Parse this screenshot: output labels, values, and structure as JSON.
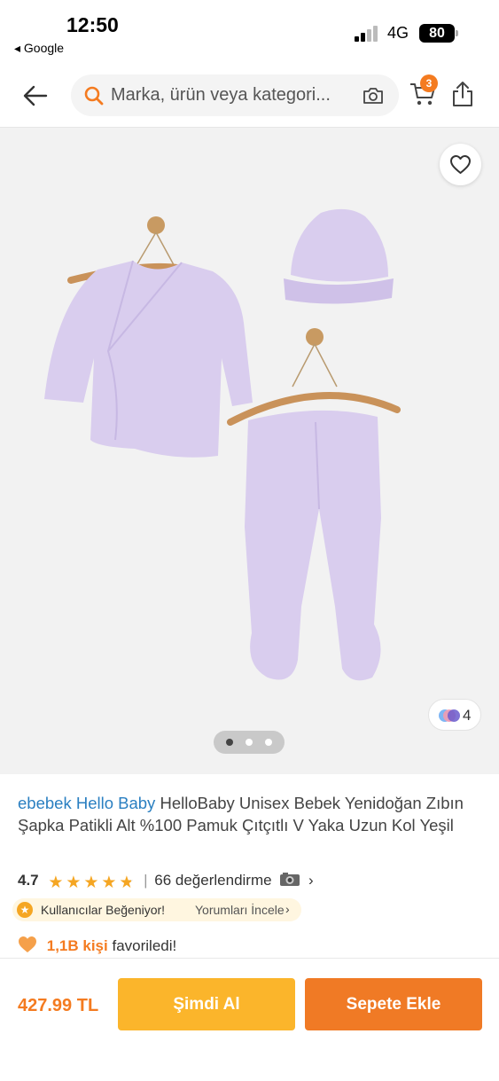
{
  "status_bar": {
    "time": "12:50",
    "back_app": "◂ Google",
    "network": "4G",
    "battery": "80"
  },
  "header": {
    "search_placeholder": "Marka, ürün veya kategori...",
    "cart_count": "3"
  },
  "gallery": {
    "color_variants_count": "4",
    "pager": {
      "total": 3,
      "active": 1
    }
  },
  "product": {
    "brand": "ebebek Hello Baby",
    "title": " HelloBaby Unisex Bebek Yenidoğan Zıbın Şapka Patikli Alt %100 Pamuk Çıtçıtlı V Yaka Uzun Kol Yeşil",
    "rating": "4.7",
    "rating_stars": 4.7,
    "reviews_separator": "|",
    "reviews": "66 değerlendirme",
    "liked_badge": "Kullanıcılar Beğeniyor!",
    "liked_link": "Yorumları İncele",
    "favorites_count": "1,1B kişi",
    "favorites_suffix": "favoriledi!"
  },
  "bottom_bar": {
    "price": "427.99 TL",
    "buy_now_label": "Şimdi Al",
    "add_to_cart_label": "Sepete Ekle"
  },
  "colors": {
    "accent_orange": "#f47b20",
    "buy_now_yellow": "#fbb52b",
    "brand_blue": "#2a7fc1",
    "star": "#f5a623",
    "garment_lilac": "#d9cdee"
  }
}
